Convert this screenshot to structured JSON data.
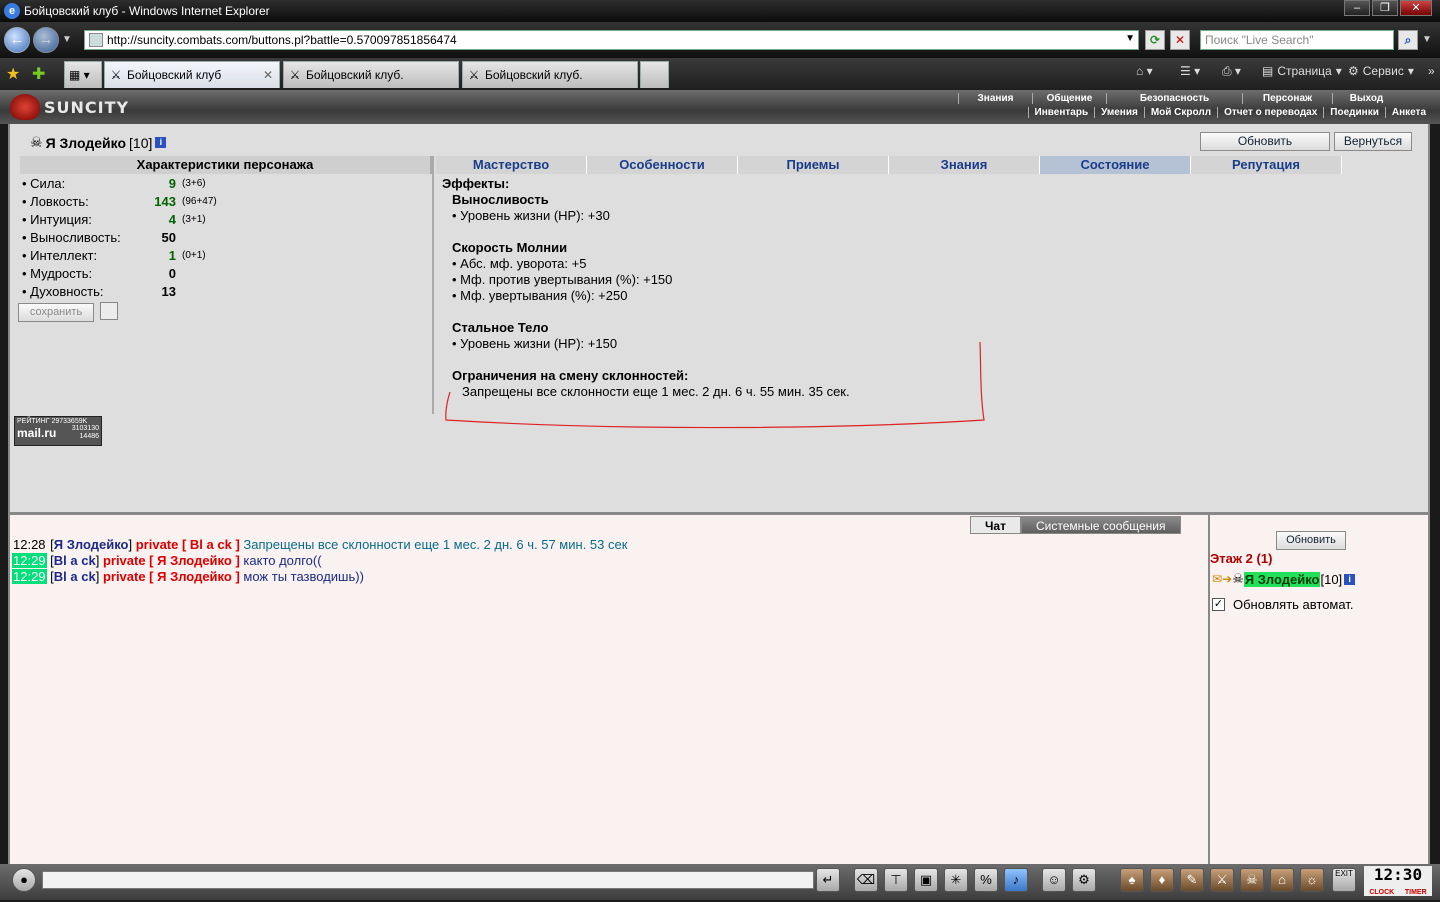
{
  "window": {
    "title": "Бойцовский клуб - Windows Internet Explorer"
  },
  "browser": {
    "address": "http://suncity.combats.com/buttons.pl?battle=0.570097851856474",
    "search_placeholder": "Поиск \"Live Search\"",
    "tabs": [
      {
        "label": "Бойцовский клуб",
        "active": true
      },
      {
        "label": "Бойцовский клуб.",
        "active": false
      },
      {
        "label": "Бойцовский клуб.",
        "active": false
      }
    ],
    "toolbar": {
      "page": "Страница",
      "tools": "Сервис"
    }
  },
  "game": {
    "logo": "SUNCITY",
    "menu_top": [
      "Знания",
      "Общение",
      "Безопасность",
      "Персонаж",
      "Выход"
    ],
    "menu_bottom": [
      "Инвентарь",
      "Умения",
      "Мой Скролл",
      "Отчет о переводах",
      "Поединки",
      "Анкета"
    ]
  },
  "character": {
    "name": "Я Злодейко",
    "level": "[10]",
    "stats_title": "Характеристики персонажа",
    "stats": [
      {
        "name": "• Сила:",
        "value": "9",
        "extra": "(3+6)"
      },
      {
        "name": "• Ловкость:",
        "value": "143",
        "extra": "(96+47)"
      },
      {
        "name": "• Интуиция:",
        "value": "4",
        "extra": "(3+1)"
      },
      {
        "name": "• Выносливость:",
        "value": "50",
        "extra": ""
      },
      {
        "name": "• Интеллект:",
        "value": "1",
        "extra": "(0+1)"
      },
      {
        "name": "• Мудрость:",
        "value": "0",
        "extra": ""
      },
      {
        "name": "• Духовность:",
        "value": "13",
        "extra": ""
      }
    ],
    "save_label": "сохранить"
  },
  "buttons": {
    "refresh": "Обновить",
    "back": "Вернуться"
  },
  "tabs": [
    "Мастерство",
    "Особенности",
    "Приемы",
    "Знания",
    "Состояние",
    "Репутация"
  ],
  "effects": {
    "heading": "Эффекты:",
    "blocks": [
      {
        "title": "Выносливость",
        "lines": [
          "• Уровень жизни (HP): +30"
        ]
      },
      {
        "title": "Скорость Молнии",
        "lines": [
          "• Абс. мф. уворота: +5",
          "• Мф. против увертывания (%): +150",
          "• Мф. увертывания (%): +250"
        ]
      },
      {
        "title": "Стальное Тело",
        "lines": [
          "• Уровень жизни (HP): +150"
        ]
      },
      {
        "title": "Ограничения на смену склонностей:",
        "lines": [
          "Запрещены все склонности еще 1 мес. 2 дн. 6 ч. 55 мин. 35 сек."
        ]
      }
    ]
  },
  "counter": {
    "line1": "РЕЙТИНГ 29733659K",
    "brand": "mail.ru",
    "n1": "3103130",
    "n2": "14486"
  },
  "chat": {
    "tab_chat": "Чат",
    "tab_sys": "Системные сообщения",
    "messages": [
      {
        "time": "12:28",
        "from": "Я Злодейко",
        "priv": "private [ Bl a ck ]",
        "text": "Запрещены все склонности еще 1 мес. 2 дн. 6 ч. 57 мин. 53 сек"
      },
      {
        "time": "12:29",
        "from": "Bl a ck",
        "priv": "private [ Я Злодейко ]",
        "text": "както долго(("
      },
      {
        "time": "12:29",
        "from": "Bl a ck",
        "priv": "private [ Я Злодейко ]",
        "text": "мож ты тазводишь))"
      }
    ]
  },
  "side": {
    "refresh": "Обновить",
    "floor": "Этаж 2 (1)",
    "user": "Я Злодейко",
    "user_level": "[10]",
    "auto_label": "Обновлять автомат."
  },
  "clock": {
    "time": "12:30",
    "clock_label": "CLOCK",
    "timer_label": "TIMER",
    "exit": "EXIT"
  }
}
